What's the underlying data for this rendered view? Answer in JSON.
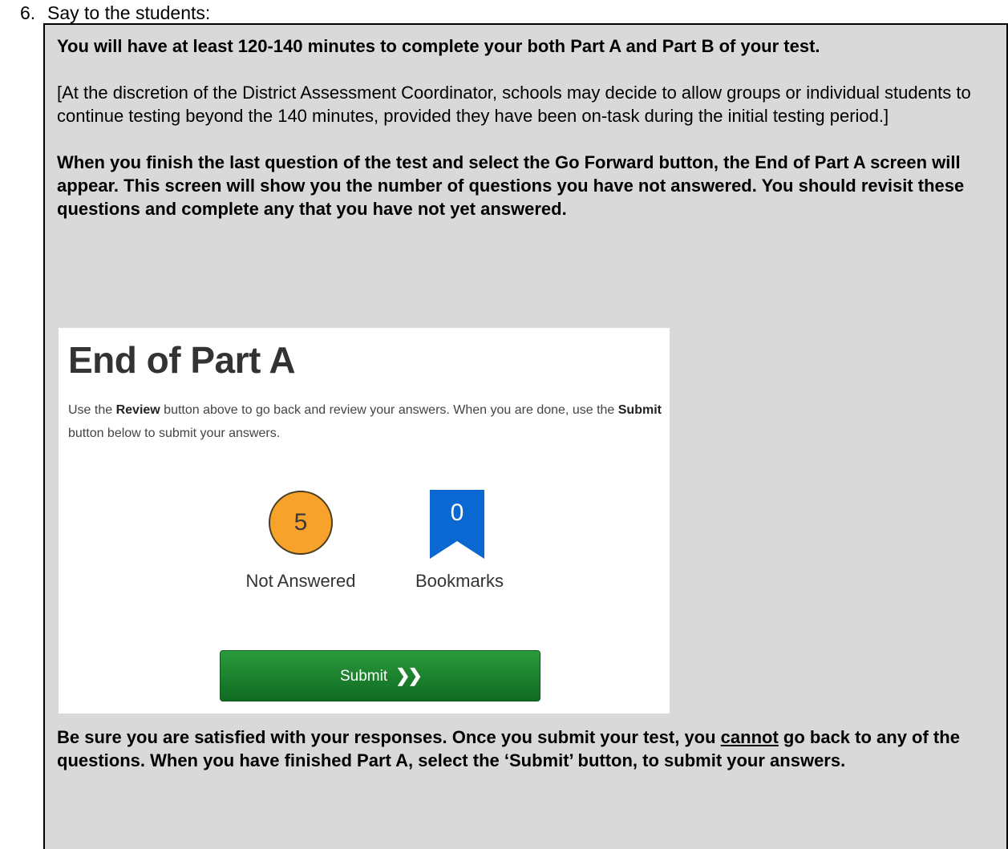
{
  "step": {
    "number": "6.",
    "text": "Say to the students:"
  },
  "script": {
    "para1": "You will have at least 120-140 minutes to complete your both Part A and Part B of your test.",
    "para2": "[At the discretion of the District Assessment Coordinator, schools may decide to allow groups or individual students to continue testing beyond the 140 minutes, provided they have been on-task during the initial testing period.]",
    "para3": "When you finish the last question of the test and select the Go Forward button, the End of Part A screen will appear. This screen will show you the number of questions you have not answered. You should revisit these questions and complete any that you have not yet answered.",
    "para4_before": "Be sure you are satisfied with your responses. Once you submit your test, you ",
    "para4_underlined": "cannot",
    "para4_after": " go back to any of the questions. When you have finished Part A, select the ‘Submit’ button, to submit your answers."
  },
  "screen": {
    "title": "End of Part A",
    "instr_1": "Use the ",
    "instr_review": "Review",
    "instr_2": " button above to go back and review your answers. When you are done, use the ",
    "instr_submit": "Submit",
    "instr_3": " button below to submit your answers.",
    "not_answered_count": "5",
    "not_answered_label": "Not Answered",
    "bookmarks_count": "0",
    "bookmarks_label": "Bookmarks",
    "submit_label": "Submit",
    "submit_icon": "double-chevron-right-icon"
  },
  "colors": {
    "box_background": "#d9d9d9",
    "not_answered_circle": "#f7a32b",
    "bookmark_blue": "#0b67d1",
    "submit_green": "#1a7f2f"
  }
}
